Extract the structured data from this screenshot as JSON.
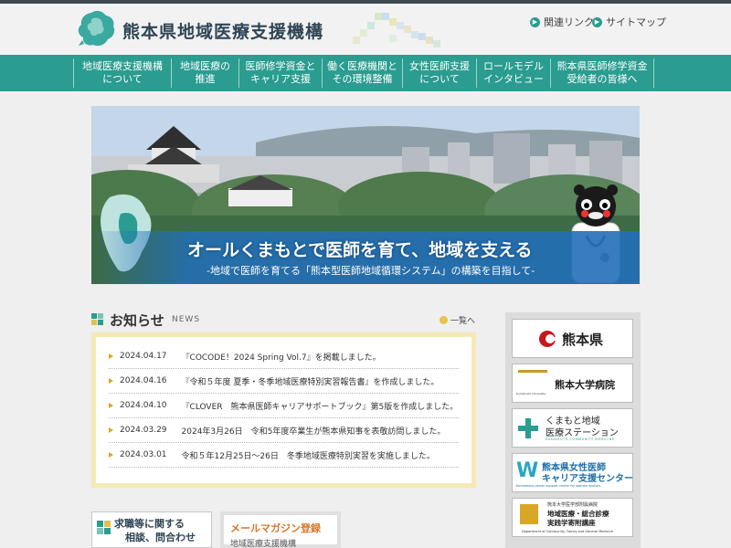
{
  "header": {
    "site_title": "熊本県地域医療支援機構",
    "links": [
      "関連リンク",
      "サイトマップ"
    ]
  },
  "nav": [
    {
      "line1": "地域医療支援機構",
      "line2": "について"
    },
    {
      "line1": "地域医療の",
      "line2": "推進"
    },
    {
      "line1": "医師修学資金と",
      "line2": "キャリア支援"
    },
    {
      "line1": "働く医療機関と",
      "line2": "その環境整備"
    },
    {
      "line1": "女性医師支援",
      "line2": "について"
    },
    {
      "line1": "ロールモデル",
      "line2": "インタビュー"
    },
    {
      "line1": "熊本県医師修学資金",
      "line2": "受給者の皆様へ"
    }
  ],
  "hero": {
    "main": "オールくまもとで医師を育て、地域を支える",
    "sub": "-地域で医師を育てる「熊本型医師地域循環システム」の構築を目指して-"
  },
  "news": {
    "title": "お知らせ",
    "title_en": "NEWS",
    "more": "一覧へ",
    "items": [
      {
        "date": "2024.04.17",
        "text": "『COCODE！2024 Spring Vol.7』を掲載しました。"
      },
      {
        "date": "2024.04.16",
        "text": "『令和５年度 夏季・冬季地域医療特別実習報告書』を作成しました。"
      },
      {
        "date": "2024.04.10",
        "text": "『CLOVER　熊本県医師キャリアサポートブック』第5版を作成しました。"
      },
      {
        "date": "2024.03.29",
        "text": "2024年3月26日　令和5年度卒業生が熊本県知事を表敬訪問しました。"
      },
      {
        "date": "2024.03.01",
        "text": "令和５年12月25日～26日　冬季地域医療特別実習を実施しました。"
      }
    ]
  },
  "side_banners": {
    "pref": "熊本県",
    "univ": "熊本大学病院",
    "univ_small": "Kumamoto University",
    "station_l1": "くまもと地域",
    "station_l2": "医療ステーション",
    "station_en": "KUMAMOTO COMMUNITY MEDICINE",
    "women_l1": "熊本県女性医師",
    "women_l2": "キャリア支援センター",
    "women_en": "Kumamoto career support center for women doctors",
    "dept_top": "熊本大学医学部附属病院",
    "dept_l1": "地域医療・総合診療",
    "dept_l2": "実践学寄附講座",
    "dept_en": "Department of Community, Family and General Medicine"
  },
  "bottom": {
    "job_l1": "求職等に関する",
    "job_l2": "相談、問合わせ",
    "mail": "メールマガジン登録",
    "mail_sub": "地域医療支援機構"
  },
  "colors": {
    "teal": "#2a9c90",
    "navy_text": "#2f4555",
    "news_frame": "#f5e9b6"
  }
}
